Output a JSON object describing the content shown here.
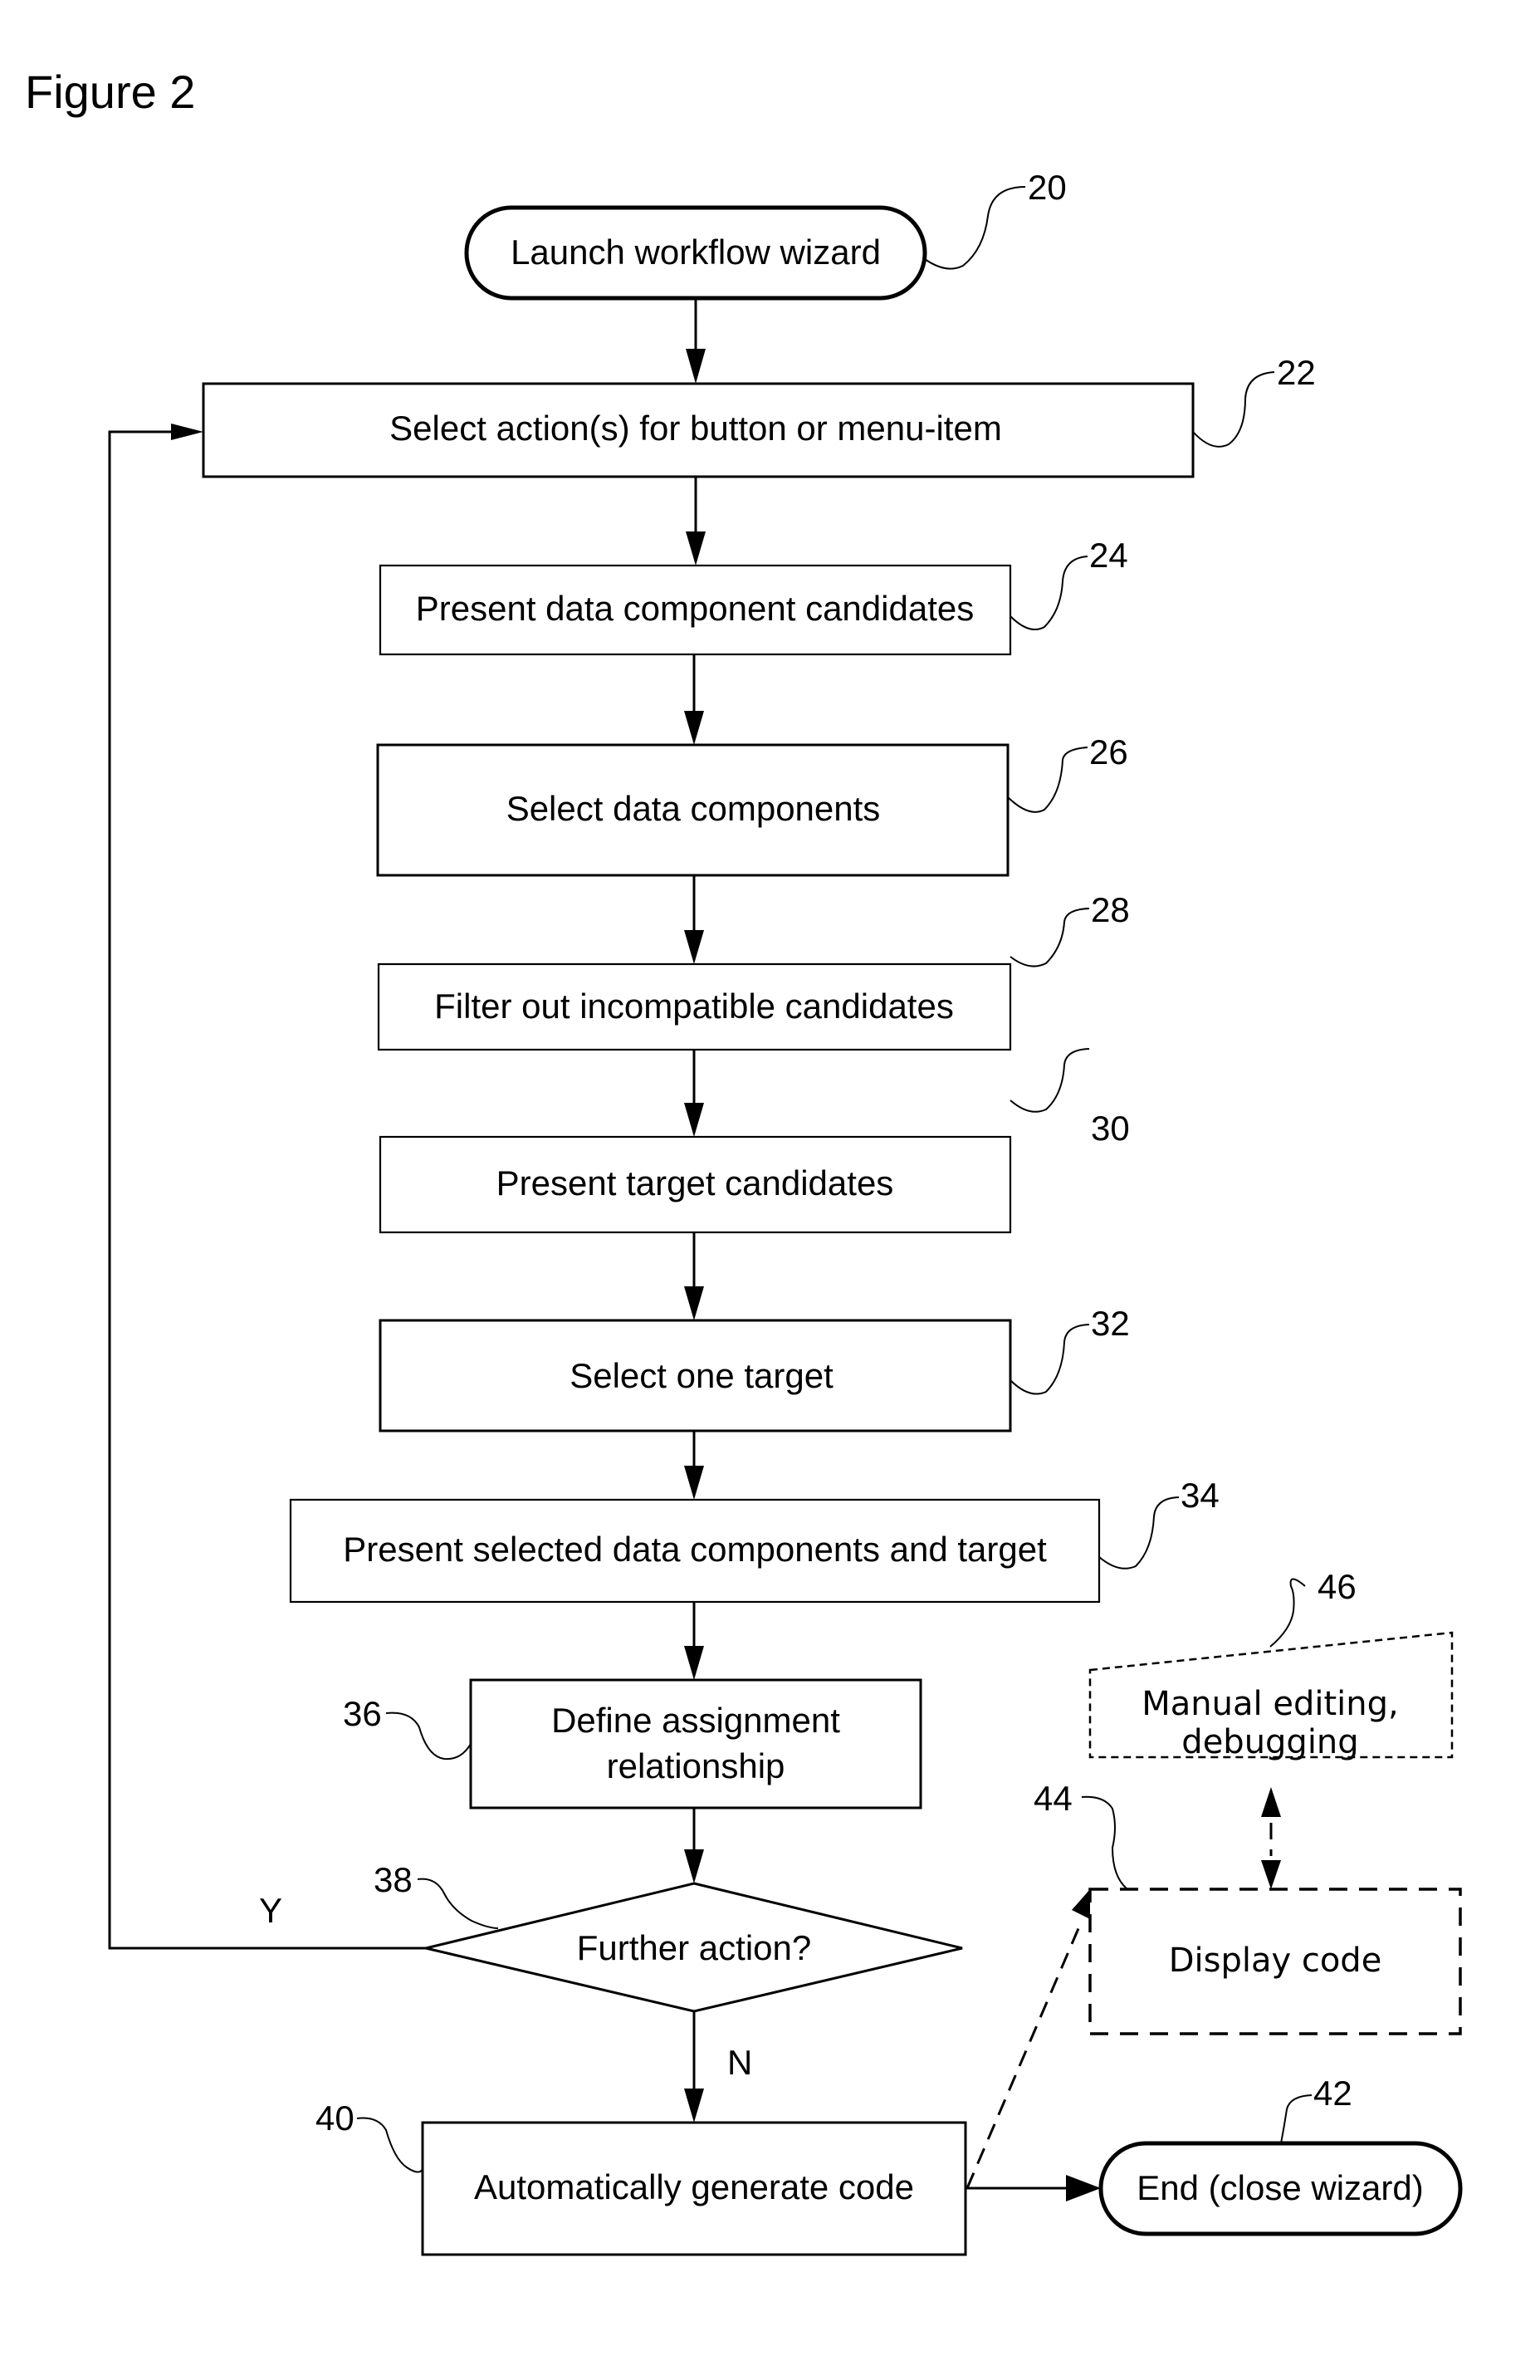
{
  "figure": {
    "title": "Figure 2"
  },
  "nodes": {
    "start": {
      "ref": "20",
      "label": "Launch workflow wizard",
      "shape": "terminal"
    },
    "select_actions": {
      "ref": "22",
      "label": "Select action(s) for button or menu-item",
      "shape": "process"
    },
    "present_data_candidates": {
      "ref": "24",
      "label": "Present data component candidates",
      "shape": "process"
    },
    "select_data_components": {
      "ref": "26",
      "label": "Select data components",
      "shape": "process"
    },
    "filter_incompatible": {
      "ref": "28",
      "label": "Filter out incompatible candidates",
      "shape": "process"
    },
    "present_target_candidates": {
      "ref": "30",
      "label": "Present target candidates",
      "shape": "process"
    },
    "select_one_target": {
      "ref": "32",
      "label": "Select one target",
      "shape": "process"
    },
    "present_selected": {
      "ref": "34",
      "label": "Present selected data components and target",
      "shape": "process"
    },
    "define_assignment": {
      "ref": "36",
      "label_lines": [
        "Define assignment",
        "relationship"
      ],
      "shape": "process"
    },
    "further_action": {
      "ref": "38",
      "label": "Further action?",
      "shape": "decision"
    },
    "generate_code": {
      "ref": "40",
      "label": "Automatically generate code",
      "shape": "process"
    },
    "end": {
      "ref": "42",
      "label": "End (close wizard)",
      "shape": "terminal"
    },
    "display_code": {
      "ref": "44",
      "label": "Display code",
      "shape": "optional-process"
    },
    "manual_editing": {
      "ref": "46",
      "label_lines": [
        "Manual editing,",
        "debugging"
      ],
      "shape": "optional-manual-input"
    }
  },
  "edges": [
    {
      "from": "start",
      "to": "select_actions"
    },
    {
      "from": "select_actions",
      "to": "present_data_candidates"
    },
    {
      "from": "present_data_candidates",
      "to": "select_data_components"
    },
    {
      "from": "select_data_components",
      "to": "filter_incompatible"
    },
    {
      "from": "filter_incompatible",
      "to": "present_target_candidates"
    },
    {
      "from": "present_target_candidates",
      "to": "select_one_target"
    },
    {
      "from": "select_one_target",
      "to": "present_selected"
    },
    {
      "from": "present_selected",
      "to": "define_assignment"
    },
    {
      "from": "define_assignment",
      "to": "further_action"
    },
    {
      "from": "further_action",
      "to": "select_actions",
      "label": "Y"
    },
    {
      "from": "further_action",
      "to": "generate_code",
      "label": "N"
    },
    {
      "from": "generate_code",
      "to": "end"
    },
    {
      "from": "generate_code",
      "to": "display_code",
      "style": "dashed"
    },
    {
      "from": "display_code",
      "to": "manual_editing",
      "style": "dashed",
      "bidirectional": true
    }
  ],
  "branch_labels": {
    "yes": "Y",
    "no": "N"
  }
}
